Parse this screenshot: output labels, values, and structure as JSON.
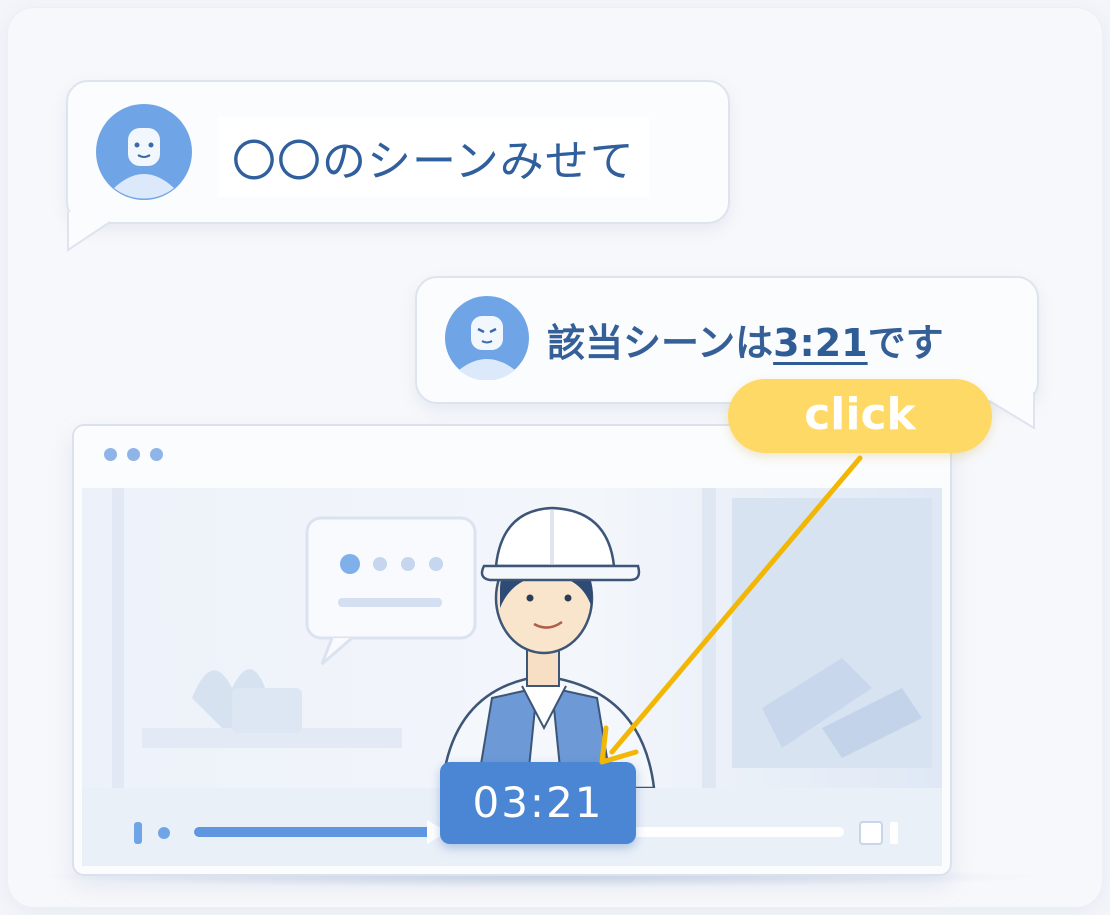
{
  "chat": {
    "user_message": "〇〇のシーンみせて",
    "bot_message_prefix": "該当シーンは",
    "bot_message_timestamp": "3:21",
    "bot_message_suffix": "です"
  },
  "annotation": {
    "click_label": "click"
  },
  "video_player": {
    "current_time": "03:21",
    "progress_fraction": 0.4
  },
  "colors": {
    "accent": "#4a86d3",
    "highlight": "#ffd966",
    "arrow": "#f2b705",
    "text_blue": "#2f5f9c"
  }
}
